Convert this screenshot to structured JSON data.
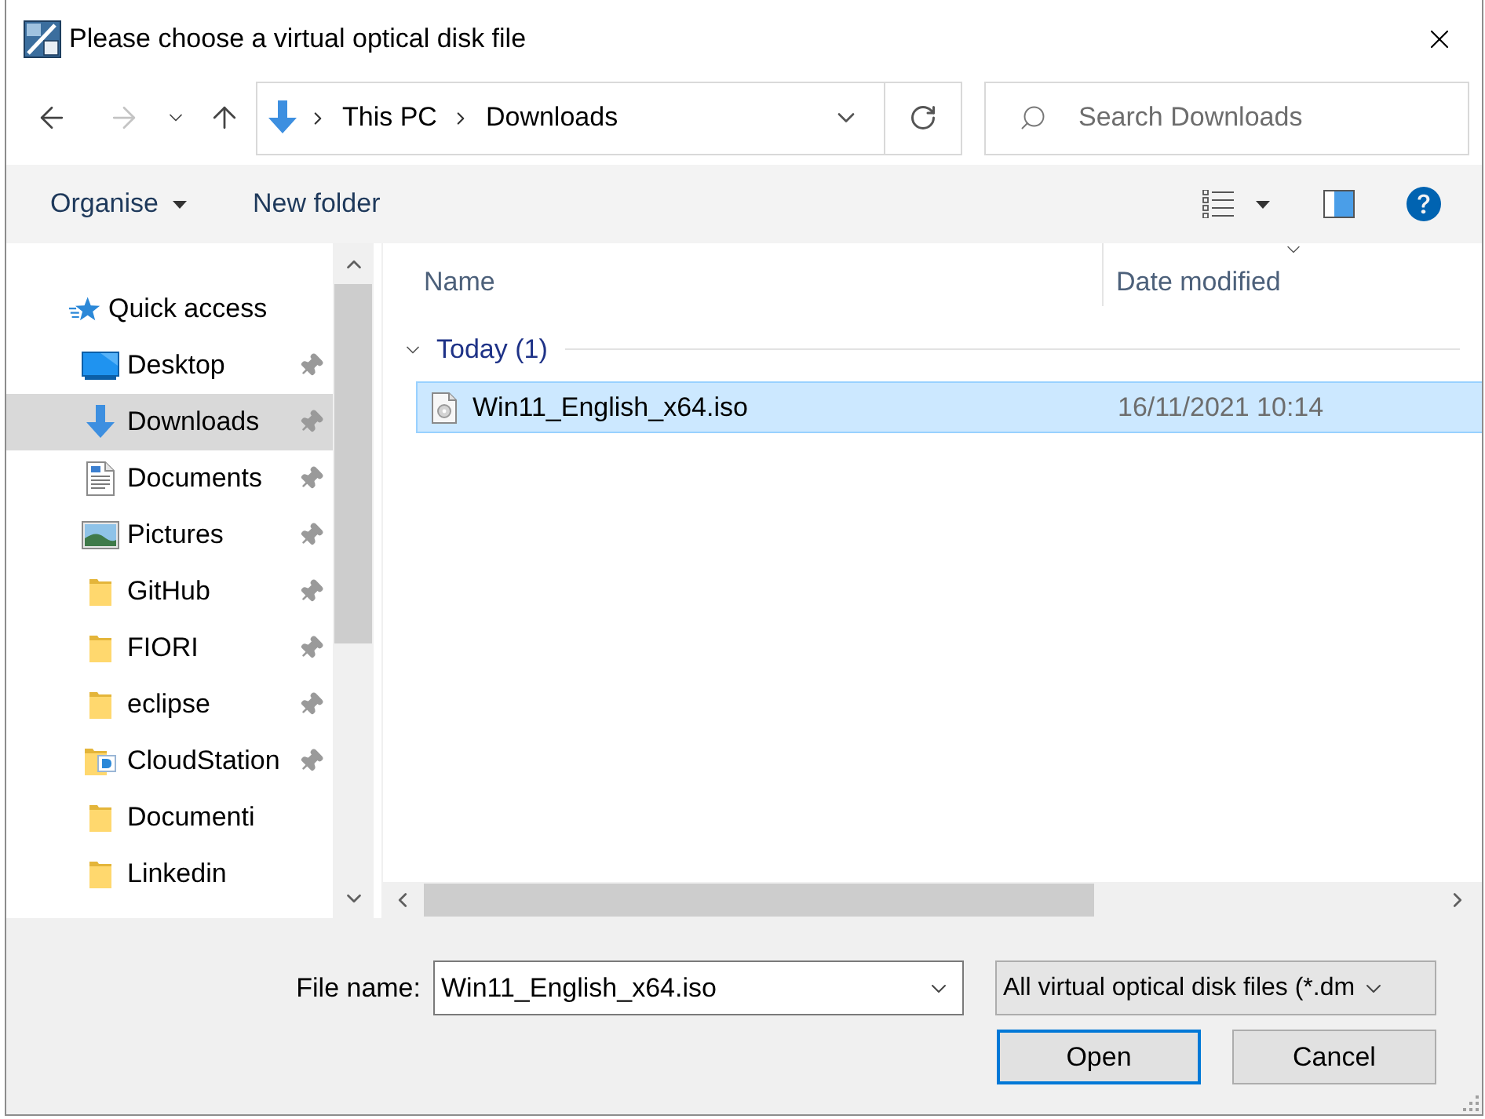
{
  "window": {
    "title": "Please choose a virtual optical disk file"
  },
  "navigation": {
    "buttons": [
      {
        "kind": "back",
        "disabled": false
      },
      {
        "kind": "forward",
        "disabled": true
      },
      {
        "kind": "recent_locations",
        "disabled": false
      },
      {
        "kind": "up",
        "disabled": false
      }
    ]
  },
  "address_bar": {
    "path": [
      "This PC",
      "Downloads"
    ]
  },
  "search": {
    "placeholder": "Search Downloads"
  },
  "toolbar": {
    "organise": "Organise",
    "new_folder": "New folder"
  },
  "sidebar": {
    "items": [
      {
        "kind": "quick_access",
        "label": "Quick access",
        "selected": false,
        "pinned": false,
        "children": [
          {
            "kind": "desktop",
            "label": "Desktop",
            "selected": false,
            "pinned": true
          },
          {
            "kind": "downloads",
            "label": "Downloads",
            "selected": true,
            "pinned": true
          },
          {
            "kind": "documents",
            "label": "Documents",
            "selected": false,
            "pinned": true
          },
          {
            "kind": "pictures",
            "label": "Pictures",
            "selected": false,
            "pinned": true
          },
          {
            "kind": "folder",
            "label": "GitHub",
            "selected": false,
            "pinned": true
          },
          {
            "kind": "folder",
            "label": "FIORI",
            "selected": false,
            "pinned": true
          },
          {
            "kind": "folder",
            "label": "eclipse",
            "selected": false,
            "pinned": true
          },
          {
            "kind": "synced_folder",
            "label": "CloudStation",
            "selected": false,
            "pinned": true
          },
          {
            "kind": "folder",
            "label": "Documenti",
            "selected": false,
            "pinned": false
          },
          {
            "kind": "folder",
            "label": "Linkedin",
            "selected": false,
            "pinned": false
          }
        ]
      }
    ]
  },
  "file_list": {
    "columns": [
      {
        "label": "Name",
        "sorted": false
      },
      {
        "label": "Date modified",
        "sorted": true
      }
    ],
    "groups": [
      {
        "label": "Today (1)",
        "expanded": true,
        "files": [
          {
            "name": "Win11_English_x64.iso",
            "date_modified": "16/11/2021 10:14",
            "selected": true
          }
        ]
      }
    ]
  },
  "footer": {
    "file_name_label": "File name:",
    "file_name": "Win11_English_x64.iso",
    "file_type": "All virtual optical disk files (*.dm",
    "buttons": [
      {
        "label": "Open",
        "default": true
      },
      {
        "label": "Cancel",
        "default": false
      }
    ]
  }
}
